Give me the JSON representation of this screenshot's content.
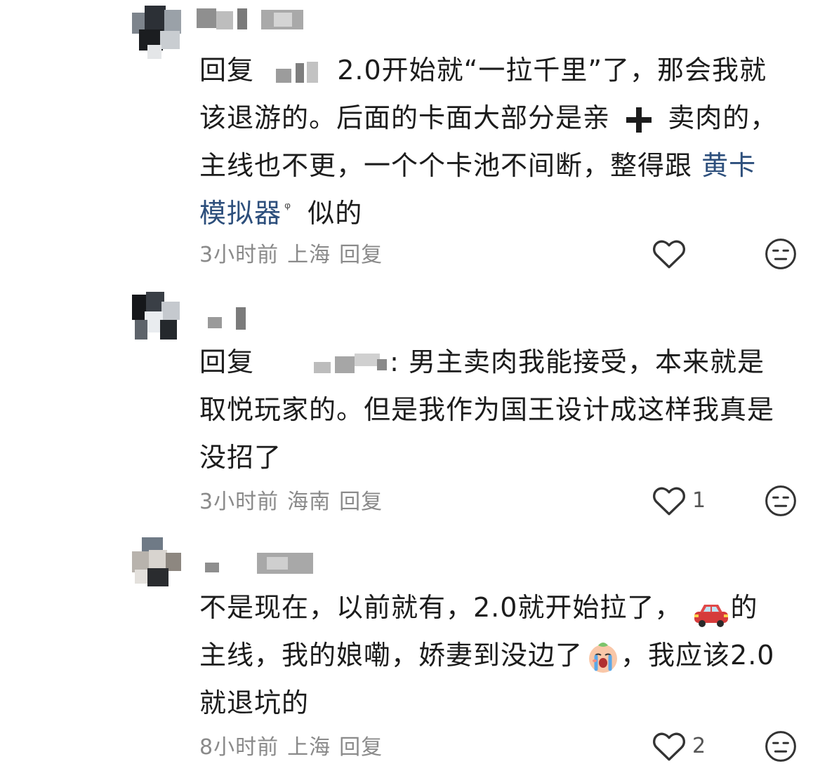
{
  "comments": [
    {
      "reply_prefix": "回复",
      "text_1": "2.0开始就“一拉千里”了，那会我就该退游的。后面的卡面大部分是亲",
      "text_2": "卖肉的，主线也不更，一个个卡池不间断，整得跟",
      "link_text": "黄卡模拟器",
      "text_3": "似的",
      "time": "3小时前",
      "location": "上海",
      "reply_label": "回复",
      "like_count": ""
    },
    {
      "reply_prefix": "回复",
      "colon": ":",
      "text_1": "男主卖肉我能接受，本来就是取悦玩家的。但是我作为国王设计成这样我真是没招了",
      "time": "3小时前",
      "location": "海南",
      "reply_label": "回复",
      "like_count": "1"
    },
    {
      "text_1": "不是现在，以前就有，2.0就开始拉了，",
      "text_2": "的主线，我的娘嘞，娇妻到没边了",
      "text_3": "，我应该2.0就退坑的",
      "time": "8小时前",
      "location": "上海",
      "reply_label": "回复",
      "like_count": "2"
    }
  ],
  "icons": {
    "like": "heart-outline-icon",
    "dislike": "meh-face-icon",
    "plus": "heavy-plus-emoji",
    "car": "red-car-emoji",
    "crying": "crying-face-emoji",
    "search_link": "search-superscript-icon"
  },
  "colors": {
    "link": "#2d4f7c",
    "meta": "#8a8a8a",
    "text": "#1c1c1c"
  }
}
